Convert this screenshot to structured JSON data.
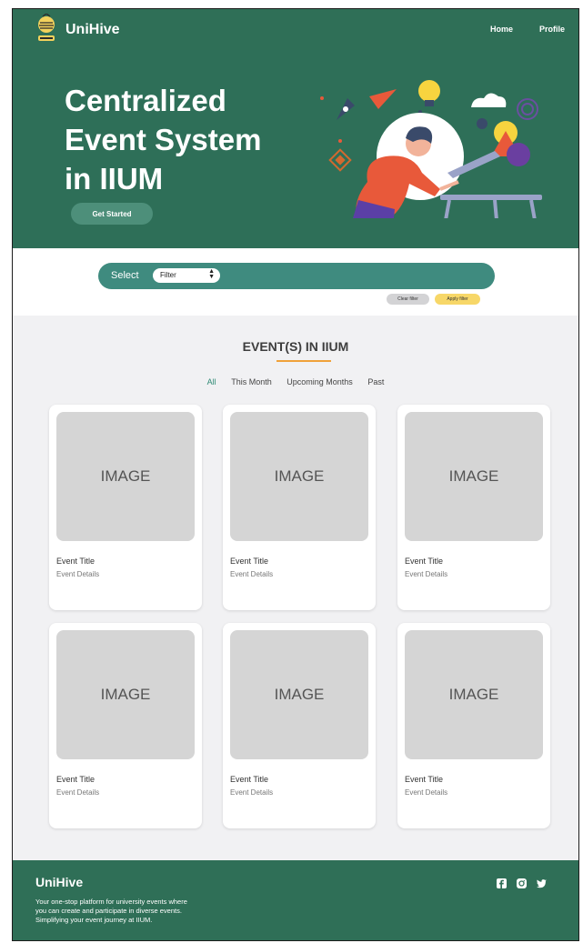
{
  "brand": {
    "name": "UniHive"
  },
  "nav": {
    "home": "Home",
    "profile": "Profile"
  },
  "hero": {
    "title_lines": [
      "Centralized",
      "Event System",
      "in IIUM"
    ],
    "cta": "Get Started"
  },
  "filter": {
    "label": "Select",
    "select_value": "Filter",
    "clear_label": "Clear filter",
    "apply_label": "Apply filter"
  },
  "events": {
    "heading": "EVENT(S) IN IIUM",
    "tabs": [
      "All",
      "This Month",
      "Upcoming Months",
      "Past"
    ],
    "active_tab": "All",
    "cards": [
      {
        "image": "IMAGE",
        "title": "Event Title",
        "details": "Event Details"
      },
      {
        "image": "IMAGE",
        "title": "Event Title",
        "details": "Event Details"
      },
      {
        "image": "IMAGE",
        "title": "Event Title",
        "details": "Event Details"
      },
      {
        "image": "IMAGE",
        "title": "Event Title",
        "details": "Event Details"
      },
      {
        "image": "IMAGE",
        "title": "Event Title",
        "details": "Event Details"
      },
      {
        "image": "IMAGE",
        "title": "Event Title",
        "details": "Event Details"
      }
    ]
  },
  "footer": {
    "brand": "UniHive",
    "lines": [
      "Your one-stop platform for university events where",
      "you can create and participate in diverse events.",
      "Simplifying your event journey at IIUM."
    ],
    "social_icons": [
      "facebook-icon",
      "instagram-icon",
      "twitter-icon"
    ]
  },
  "colors": {
    "primary": "#2f6f57",
    "filter_bar": "#3f8b7f",
    "accent": "#f0a23a",
    "apply": "#f7d768"
  }
}
